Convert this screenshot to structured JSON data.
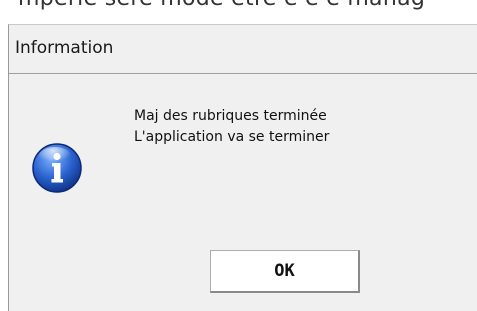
{
  "background_partial_text": "mpérié seré mode être é é e manag",
  "dialog": {
    "title": "Information",
    "message_line1": "Maj des rubriques terminée",
    "message_line2": "L'application va se terminer",
    "icon": "information-icon",
    "ok_label": "OK"
  },
  "colors": {
    "dialog_bg": "#f0f0f0",
    "icon_blue": "#1a4fb8"
  }
}
